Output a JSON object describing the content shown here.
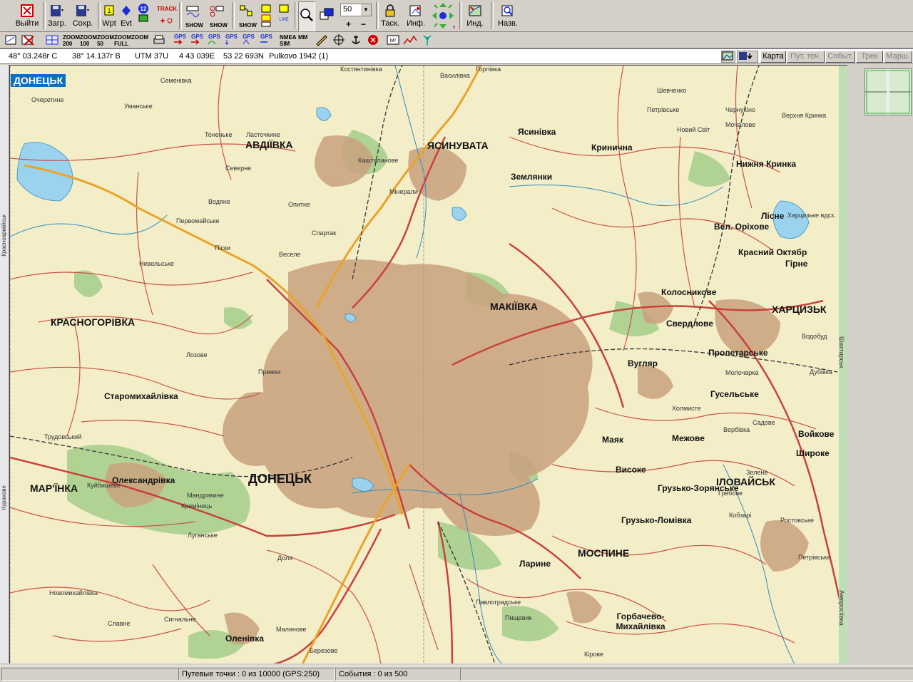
{
  "toolbar": {
    "exit": "Выйти",
    "load": "Загр.",
    "save": "Сохр.",
    "wpt": "Wpt",
    "evt": "Evt",
    "badge12": "12",
    "track": "TRACK",
    "show": "SHOW",
    "zoom_value": "50",
    "tasks": "Таск.",
    "info": "Инф.",
    "ind": "Инд.",
    "names": "Назв."
  },
  "toolbar2": {
    "zoom200": "ZOOM 200",
    "zoom100": "ZOOM 100",
    "zoom50": "ZOOM 50",
    "zoomfull": "ZOOM FULL",
    "zoom": "ZOOM",
    "gps": "GPS",
    "nmea_sim": "NMEA SIM",
    "mm": "MM"
  },
  "coords": {
    "lat": "48° 03.248г С",
    "lon": "38° 14.137г В",
    "utm": "UTM 37U",
    "easting": "4 43 039E",
    "northing": "53 22 693N",
    "datum": "Pulkovo 1942 (1)"
  },
  "tabs": [
    {
      "label": "Карта",
      "enabled": true
    },
    {
      "label": "Пут. точ.",
      "enabled": false
    },
    {
      "label": "Событ.",
      "enabled": false
    },
    {
      "label": "Трек",
      "enabled": false
    },
    {
      "label": "Марш.",
      "enabled": false
    }
  ],
  "map": {
    "region_label": "ДОНЕЦЬК",
    "edge_top": [
      "Костянтинівка",
      "Горлівка"
    ],
    "edge_left": [
      "Красноармійськ",
      "Курахове"
    ],
    "edge_right": [
      "Шахтарськ",
      "Амвросіївка"
    ],
    "cities": {
      "donetsk": "ДОНЕЦЬК",
      "makiivka": "МАКІЇВКА",
      "avdiivka": "АВДІЇВКА",
      "yasynuvata": "ЯСИНУВАТА",
      "kharcyzk": "ХАРЦИЗЬК",
      "krasnohorivka": "КРАСНОГОРІВКА",
      "marinka": "МАР'ЇНКА",
      "ilovaisk": "ІЛОВАЙСЬК",
      "mospyne": "МОСПИНЕ"
    },
    "towns": [
      "Ясинівка",
      "Кринична",
      "Землянки",
      "Нижня Кринка",
      "Лісне",
      "Вел. Оріхове",
      "Красний Октябр",
      "Гірне",
      "Колосникове",
      "Свердлове",
      "Пролетарське",
      "Вугляр",
      "Гусельське",
      "Войкове",
      "Широке",
      "Маяк",
      "Межове",
      "Високе",
      "Грузько-Зорянське",
      "Грузько-Ломівка",
      "Ларине",
      "Горбачево-Михайлівка",
      "Старомихайлівка",
      "Олександрівка",
      "Оленівка"
    ],
    "villages": [
      "Семенівка",
      "Уманське",
      "Очеретине",
      "Тоненьке",
      "Ласточкине",
      "Северне",
      "Водяне",
      "Опитне",
      "Первомайське",
      "Піски",
      "Веселе",
      "Спартак",
      "Невельське",
      "Лозове",
      "Пряжки",
      "Куйбишеве",
      "Трудовський",
      "Мандрикине",
      "Кремінець",
      "Луганське",
      "Доля",
      "Сигнальне",
      "Славне",
      "Новомихайлівка",
      "Малинове",
      "Березове",
      "Павлоградське",
      "Пищевик",
      "Кірове",
      "Верхня Кринка",
      "Шевченко",
      "Холмисте",
      "Мочалове",
      "Кашталанове",
      "Мінерали",
      "Василівка",
      "Петрівське",
      "Новий Світ",
      "Чернухіно",
      "Харцизьке вдсх.",
      "Молочарка",
      "Дубівка",
      "Водобуд",
      "Зелене",
      "Садове",
      "Вербівка",
      "Кобзарі",
      "Гребове",
      "Петрівське",
      "Ростовське"
    ]
  },
  "status": {
    "waypoints": "Путевые точки : 0 из 10000  (GPS:250)",
    "events": "События : 0 из 500"
  }
}
